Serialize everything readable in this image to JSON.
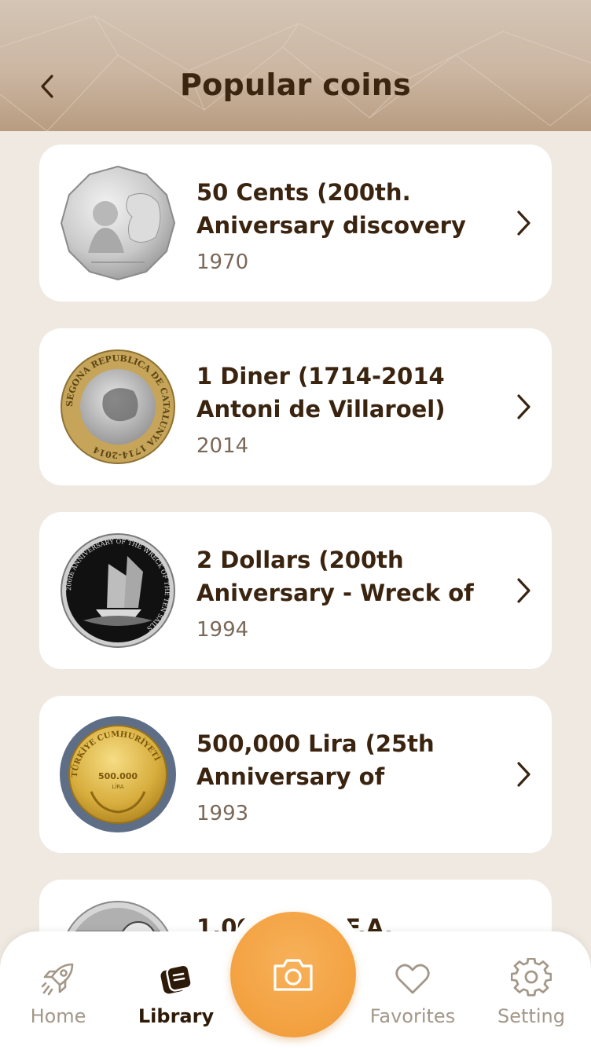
{
  "header": {
    "title": "Popular coins"
  },
  "coins": [
    {
      "title": "50 Cents (200th. Aniversary discovery",
      "year": "1970"
    },
    {
      "title": "1 Diner (1714-2014 Antoni de Villaroel)",
      "year": "2014"
    },
    {
      "title": "2 Dollars (200th Aniversary - Wreck of",
      "year": "1994"
    },
    {
      "title": "500,000 Lira (25th Anniversary of",
      "year": "1993"
    },
    {
      "title": "1,000 … F.I.F.A.",
      "year": ""
    }
  ],
  "coin_text": {
    "coin2_ring": "SEGONA REPUBLICA DE CATALUNYA 1714-2014",
    "coin3_ring": "200th ANNIVERSARY OF THE WRECK OF THE TEN SAILS",
    "coin4_top": "TÜRKİYE CUMHURİYETİ",
    "coin4_value": "500.000",
    "coin4_unit": "LİRA"
  },
  "nav": {
    "home": "Home",
    "library": "Library",
    "favorites": "Favorites",
    "setting": "Setting"
  },
  "colors": {
    "accent": "#f3a140",
    "text_dark": "#3a2410",
    "text_muted": "#7a6858",
    "background": "#efe9e2"
  },
  "icons": {
    "back": "chevron-left-icon",
    "card": "chevron-right-icon",
    "home": "rocket-icon",
    "library": "library-icon",
    "camera": "camera-icon",
    "favorites": "heart-icon",
    "setting": "gear-icon"
  }
}
